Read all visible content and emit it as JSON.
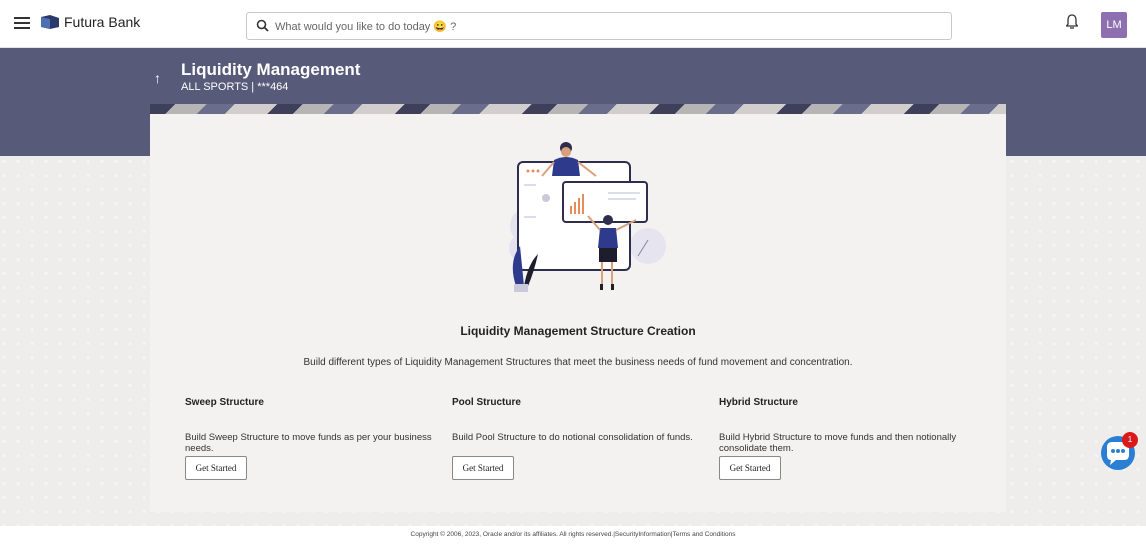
{
  "app": {
    "brand_name": "Futura Bank",
    "search_placeholder": "What would you like to do today 😀 ?",
    "user_initials": "LM",
    "accent_color": "#585a7a",
    "avatar_color": "#8e6fb0"
  },
  "header": {
    "title": "Liquidity Management",
    "subtitle": "ALL SPORTS | ***464"
  },
  "main": {
    "heading": "Liquidity Management Structure Creation",
    "description": "Build different types of Liquidity Management Structures that meet the business needs of fund movement and concentration.",
    "structures": [
      {
        "title": "Sweep Structure",
        "description": "Build Sweep Structure to move funds as per your business needs.",
        "button": "Get Started"
      },
      {
        "title": "Pool Structure",
        "description": "Build Pool Structure to do notional consolidation of funds.",
        "button": "Get Started"
      },
      {
        "title": "Hybrid Structure",
        "description": "Build Hybrid Structure to move funds and then notionally consolidate them.",
        "button": "Get Started"
      }
    ]
  },
  "chat": {
    "badge_count": "1"
  },
  "footer": {
    "text": "Copyright © 2006, 2023, Oracle and/or its affiliates. All rights reserved.|SecurityInformation|Terms and Conditions"
  },
  "icons": [
    "menu-icon",
    "bank-logo-icon",
    "search-icon",
    "bell-icon",
    "back-arrow-icon",
    "chat-icon"
  ]
}
